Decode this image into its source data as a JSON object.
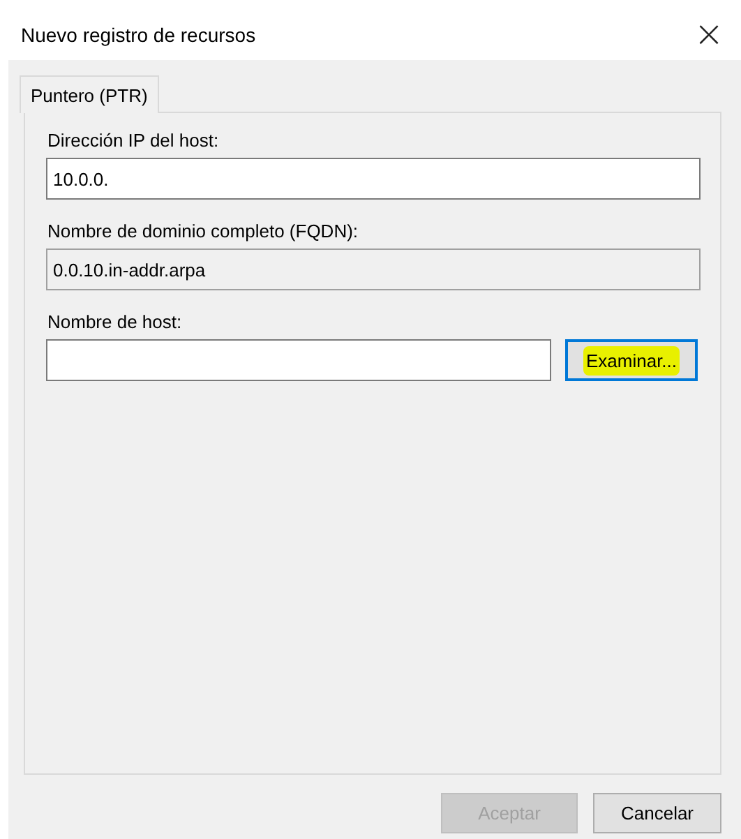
{
  "window": {
    "title": "Nuevo registro de recursos",
    "close": "×"
  },
  "tabs": [
    {
      "label": "Puntero (PTR)",
      "selected": true
    }
  ],
  "fields": [
    {
      "label": "Dirección IP del host:",
      "value": "10.0.0.",
      "readonly": false
    },
    {
      "label": "Nombre de dominio completo (FQDN):",
      "value": "0.0.10.in-addr.arpa",
      "readonly": true
    }
  ],
  "host": {
    "label": "Nombre de host:",
    "button": {
      "label": "Examinar...",
      "focused": true,
      "highlighted": true
    }
  },
  "buttons": [
    {
      "label": "Aceptar",
      "disabled": true
    },
    {
      "label": "Cancelar",
      "disabled": false
    }
  ]
}
